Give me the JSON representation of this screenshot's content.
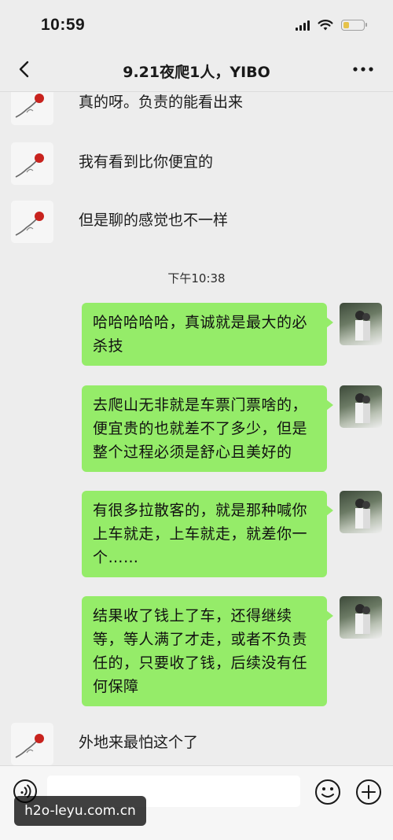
{
  "status_bar": {
    "time": "10:59"
  },
  "nav": {
    "title": "9.21夜爬1人，YIBO"
  },
  "messages_left_top": [
    {
      "text": "真的呀。负责的能看出来"
    },
    {
      "text": "我有看到比你便宜的"
    },
    {
      "text": "但是聊的感觉也不一样"
    }
  ],
  "timestamp": "下午10:38",
  "messages_right": [
    {
      "text": "哈哈哈哈哈，真诚就是最大的必杀技"
    },
    {
      "text": "去爬山无非就是车票门票啥的，便宜贵的也就差不了多少，但是整个过程必须是舒心且美好的"
    },
    {
      "text": "有很多拉散客的，就是那种喊你上车就走，上车就走，就差你一个……"
    },
    {
      "text": "结果收了钱上了车，还得继续等，等人满了才走，或者不负责任的，只要收了钱，后续没有任何保障"
    }
  ],
  "message_left_bottom": {
    "text": "外地来最怕这个了"
  },
  "watermark": "h2o-leyu.com.cn",
  "colors": {
    "bubble": "#95ec69",
    "background": "#ededed"
  },
  "icons": [
    "back-icon",
    "more-icon",
    "voice-icon",
    "emoji-icon",
    "plus-icon"
  ]
}
